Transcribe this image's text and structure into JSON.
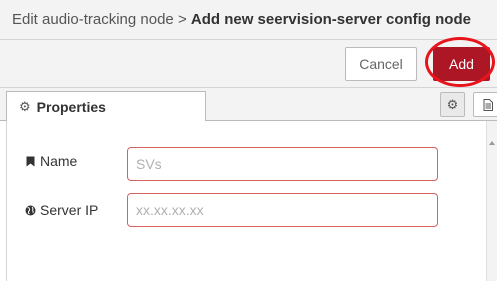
{
  "header": {
    "breadcrumb_parent": "Edit audio-tracking node",
    "separator": ">",
    "title": "Add new seervision-server config node"
  },
  "buttons": {
    "cancel_label": "Cancel",
    "add_label": "Add"
  },
  "tabs": {
    "properties_icon": "gear-icon",
    "properties_label": "Properties",
    "actions": [
      "gear-icon",
      "document-icon"
    ]
  },
  "form": {
    "name": {
      "icon": "bookmark-icon",
      "label": "Name",
      "value": "",
      "placeholder": "SVs"
    },
    "server_ip": {
      "icon": "globe-icon",
      "label": "Server IP",
      "value": "",
      "placeholder": "xx.xx.xx.xx"
    }
  },
  "colors": {
    "add_button": "#ad1625",
    "annotation_circle": "#e8141c",
    "invalid_border": "#d6615f"
  }
}
